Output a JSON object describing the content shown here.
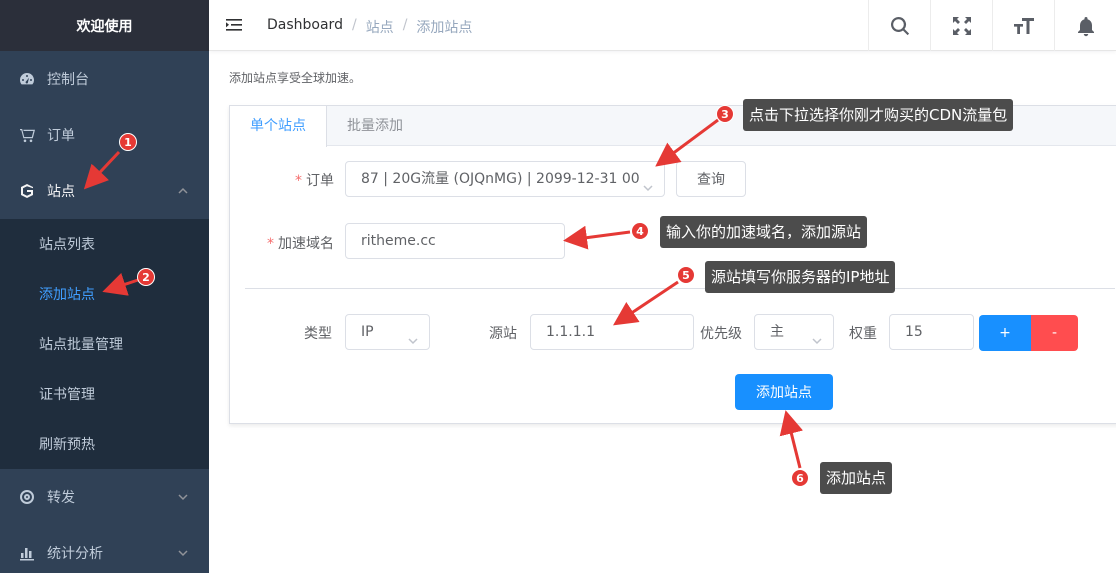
{
  "sidebar": {
    "title": "欢迎使用",
    "items": [
      {
        "label": "控制台"
      },
      {
        "label": "订单"
      },
      {
        "label": "站点"
      },
      {
        "label": "转发"
      },
      {
        "label": "统计分析"
      }
    ],
    "submenu": [
      {
        "label": "站点列表"
      },
      {
        "label": "添加站点"
      },
      {
        "label": "站点批量管理"
      },
      {
        "label": "证书管理"
      },
      {
        "label": "刷新预热"
      }
    ]
  },
  "breadcrumb": [
    "Dashboard",
    "站点",
    "添加站点"
  ],
  "main": {
    "description": "添加站点享受全球加速。",
    "tabs": [
      {
        "label": "单个站点"
      },
      {
        "label": "批量添加"
      }
    ],
    "form": {
      "order_label": "订单",
      "order_value": "87 | 20G流量 (OJQnMG)  | 2099-12-31 00",
      "query_button": "查询",
      "domain_label": "加速域名",
      "domain_value": "ritheme.cc",
      "type_label": "类型",
      "type_value": "IP",
      "origin_label": "源站",
      "origin_value": "1.1.1.1",
      "priority_label": "优先级",
      "priority_value": "主",
      "weight_label": "权重",
      "weight_value": "15",
      "plus_button": "+",
      "minus_button": "-",
      "submit_button": "添加站点"
    }
  },
  "annotations": [
    {
      "number": "1"
    },
    {
      "number": "2"
    },
    {
      "number": "3",
      "text": "点击下拉选择你刚才购买的CDN流量包"
    },
    {
      "number": "4",
      "text": "输入你的加速域名，添加源站"
    },
    {
      "number": "5",
      "text": "源站填写你服务器的IP地址"
    },
    {
      "number": "6",
      "text": "添加站点"
    }
  ],
  "colors": {
    "sidebar": "#304156",
    "accent": "#409eff",
    "primary": "#1890ff",
    "danger": "#ff4d4f",
    "annotation": "#e53935"
  }
}
